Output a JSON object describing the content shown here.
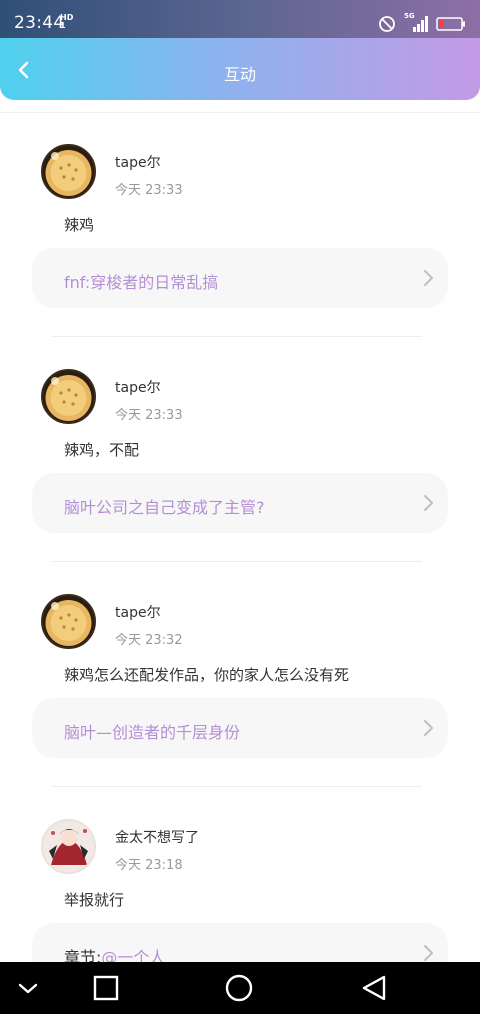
{
  "status_bar": {
    "time": "23:44",
    "hd_top": "HD",
    "hd_bottom": "1",
    "signal_label": "5G",
    "icons": [
      "do-not-disturb-icon",
      "signal-icon",
      "battery-low-icon"
    ]
  },
  "header": {
    "title": "互动",
    "back_icon": "chevron-left-icon"
  },
  "comments": [
    {
      "user": "tape尔",
      "time": "今天 23:33",
      "text": "辣鸡",
      "ref_prefix": "fnf:",
      "ref_title": "穿梭者的日常乱搞",
      "avatar": "cookie"
    },
    {
      "user": "tape尔",
      "time": "今天 23:33",
      "text": "辣鸡，不配",
      "ref_prefix": "",
      "ref_title": "脑叶公司之自己变成了主管?",
      "avatar": "cookie"
    },
    {
      "user": "tape尔",
      "time": "今天 23:32",
      "text": "辣鸡怎么还配发作品，你的家人怎么没有死",
      "ref_prefix": "",
      "ref_title": "脑叶—创造者的千层身份",
      "avatar": "cookie"
    },
    {
      "user": "金太不想写了",
      "time": "今天 23:18",
      "text": "举报就行",
      "ref_prefix": "章节:",
      "ref_title": "@一个人",
      "avatar": "anime"
    }
  ],
  "colors": {
    "accent": "#b48fd6",
    "header_gradient_start": "#4fd1ee",
    "header_gradient_end": "#c39ae6"
  },
  "nav_bar": {
    "icons": [
      "collapse-icon",
      "recents-icon",
      "home-icon",
      "back-icon"
    ]
  }
}
